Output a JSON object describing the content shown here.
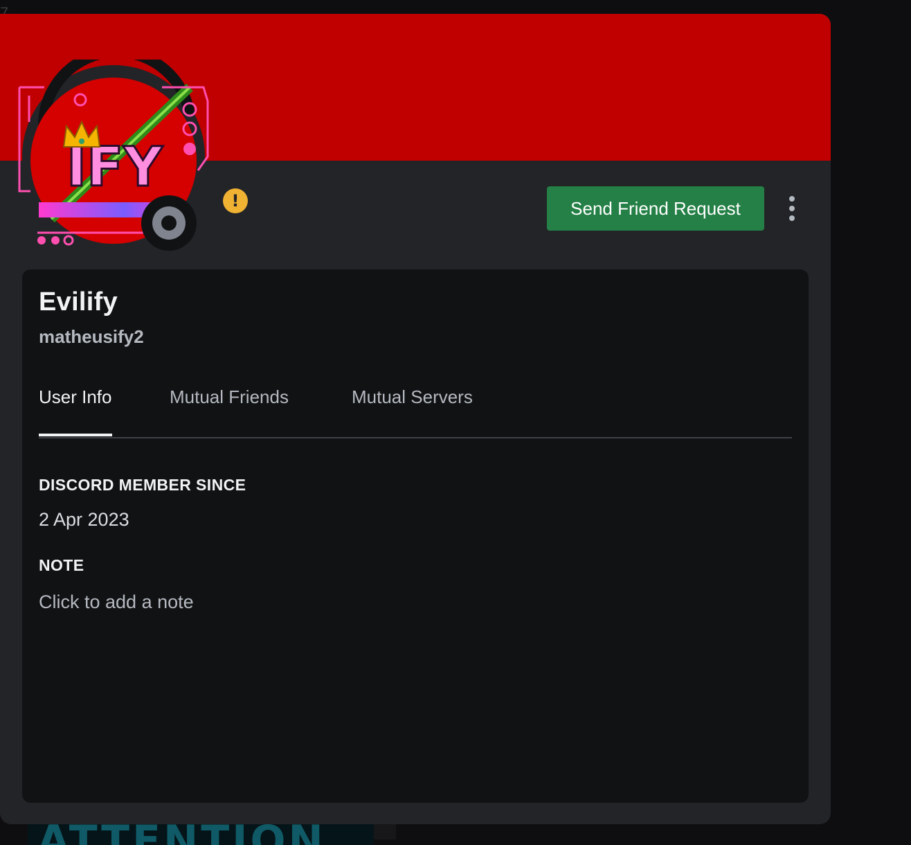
{
  "profile": {
    "banner_color": "#c00000",
    "display_name": "Evilify",
    "username": "matheusify2",
    "avatar_art_text": "IFY",
    "avatar_status": "offline",
    "warning_badge": "!",
    "friend_button": {
      "label": "Send Friend Request",
      "color": "#248046"
    },
    "more_icon": "vertical-ellipsis-icon"
  },
  "tabs": [
    {
      "label": "User Info",
      "active": true
    },
    {
      "label": "Mutual Friends",
      "active": false
    },
    {
      "label": "Mutual Servers",
      "active": false
    }
  ],
  "user_info": {
    "member_since_heading": "DISCORD MEMBER SINCE",
    "member_since_value": "2 Apr 2023",
    "note_heading": "NOTE",
    "note_placeholder": "Click to add a note"
  },
  "background": {
    "banner_text": "ATTENTION"
  }
}
